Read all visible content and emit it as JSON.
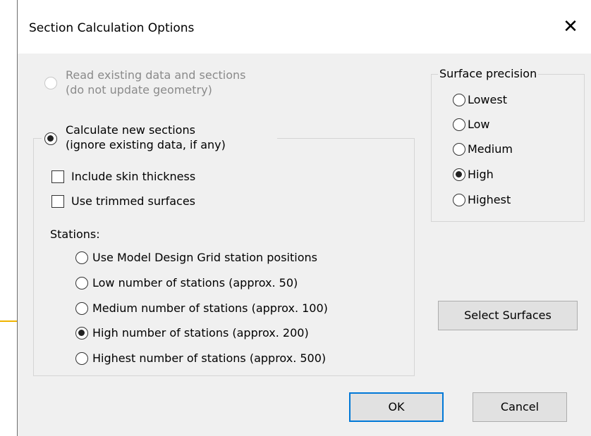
{
  "dialog": {
    "title": "Section Calculation Options",
    "close_glyph": "✕"
  },
  "options": {
    "read_existing": {
      "line1": "Read existing data and sections",
      "line2": "(do not update geometry)",
      "checked": false,
      "enabled": false
    },
    "calculate_new": {
      "line1": "Calculate new sections",
      "line2": "(ignore existing data, if any)",
      "checked": true
    }
  },
  "checkboxes": [
    {
      "label": "Include skin thickness",
      "checked": false
    },
    {
      "label": "Use trimmed surfaces",
      "checked": false
    }
  ],
  "stations": {
    "label": "Stations:",
    "options": [
      {
        "label": "Use Model Design Grid station positions",
        "checked": false
      },
      {
        "label": "Low number of stations (approx. 50)",
        "checked": false
      },
      {
        "label": "Medium number of stations (approx. 100)",
        "checked": false
      },
      {
        "label": "High number of stations (approx. 200)",
        "checked": true
      },
      {
        "label": "Highest number of stations (approx. 500)",
        "checked": false
      }
    ]
  },
  "surface_precision": {
    "label": "Surface precision",
    "options": [
      {
        "label": "Lowest",
        "checked": false
      },
      {
        "label": "Low",
        "checked": false
      },
      {
        "label": "Medium",
        "checked": false
      },
      {
        "label": "High",
        "checked": true
      },
      {
        "label": "Highest",
        "checked": false
      }
    ]
  },
  "buttons": {
    "select_surfaces": "Select Surfaces",
    "ok": "OK",
    "cancel": "Cancel"
  },
  "colors": {
    "accent_line": "#f0b400",
    "default_button_border": "#0078d7",
    "dialog_bg": "#f0f0f0"
  }
}
